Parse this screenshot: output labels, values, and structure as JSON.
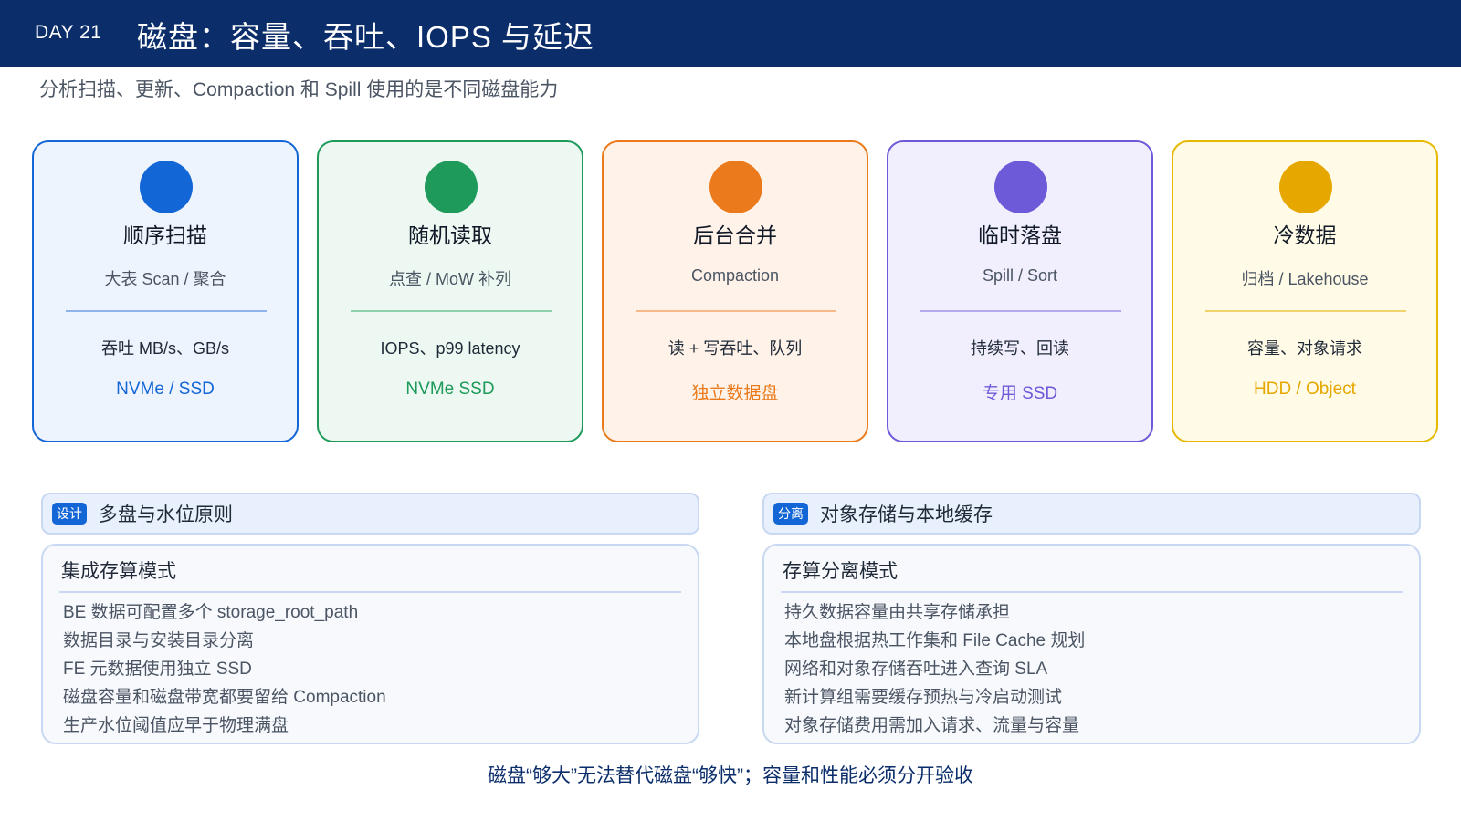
{
  "header": {
    "day": "DAY 21",
    "title": "磁盘：容量、吞吐、IOPS 与延迟"
  },
  "subtitle": "分析扫描、更新、Compaction 和 Spill 使用的是不同磁盘能力",
  "colors": {
    "header_bg": "#0b2e6b",
    "blue": "#1366d6",
    "green": "#1e9a5b",
    "orange": "#ea7a1c",
    "purple": "#6d5ad8",
    "gold": "#e6a700"
  },
  "cards": [
    {
      "name": "顺序扫描",
      "sub": "大表 Scan / 聚合",
      "metric": "吞吐 MB/s、GB/s",
      "media": "NVMe / SSD"
    },
    {
      "name": "随机读取",
      "sub": "点查 / MoW 补列",
      "metric": "IOPS、p99 latency",
      "media": "NVMe SSD"
    },
    {
      "name": "后台合并",
      "sub": "Compaction",
      "metric": "读 + 写吞吐、队列",
      "media": "独立数据盘"
    },
    {
      "name": "临时落盘",
      "sub": "Spill / Sort",
      "metric": "持续写、回读",
      "media": "专用 SSD"
    },
    {
      "name": "冷数据",
      "sub": "归档 / Lakehouse",
      "metric": "容量、对象请求",
      "media": "HDD / Object"
    }
  ],
  "left_panel": {
    "tag": "设计",
    "title": "多盘与水位原则",
    "body_title": "集成存算模式",
    "items": [
      "BE 数据可配置多个 storage_root_path",
      "数据目录与安装目录分离",
      "FE 元数据使用独立 SSD",
      "磁盘容量和磁盘带宽都要留给 Compaction",
      "生产水位阈值应早于物理满盘"
    ]
  },
  "right_panel": {
    "tag": "分离",
    "title": "对象存储与本地缓存",
    "body_title": "存算分离模式",
    "items": [
      "持久数据容量由共享存储承担",
      "本地盘根据热工作集和 File Cache 规划",
      "网络和对象存储吞吐进入查询 SLA",
      "新计算组需要缓存预热与冷启动测试",
      "对象存储费用需加入请求、流量与容量"
    ]
  },
  "footer": "磁盘“够大”无法替代磁盘“够快”；容量和性能必须分开验收"
}
